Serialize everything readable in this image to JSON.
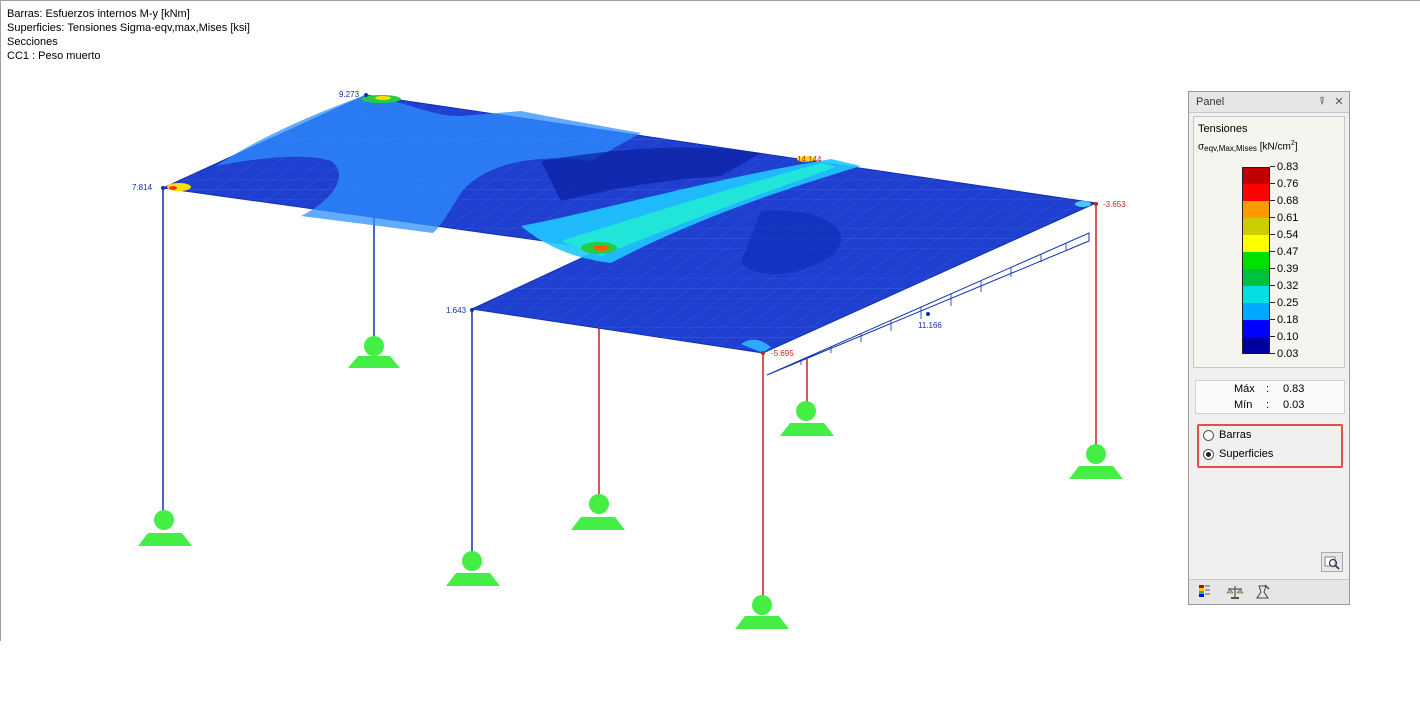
{
  "info": {
    "line1": "Barras: Esfuerzos internos M-y [kNm]",
    "line2": "Superficies: Tensiones Sigma-eqv,max,Mises [ksi]",
    "line3": "Secciones",
    "line4": "CC1 : Peso muerto"
  },
  "labels": {
    "v1": "9.273",
    "v2": "7.814",
    "v3": "1.643",
    "v4": "-3.653",
    "v5": "-5.695",
    "v6": "11.166",
    "v7": "14.144"
  },
  "panel": {
    "title": "Panel",
    "pin_icon": "pin-icon",
    "close_icon": "close-icon",
    "heading": "Tensiones",
    "quantity_symbol": "σ",
    "quantity_sub": "eqv,Max,Mises",
    "quantity_unit": "[kN/cm",
    "quantity_unit_exp": "2",
    "quantity_unit_close": "]",
    "legend": [
      {
        "value": "0.83",
        "color": "#c00000"
      },
      {
        "value": "0.76",
        "color": "#ff0000"
      },
      {
        "value": "0.68",
        "color": "#ff9900"
      },
      {
        "value": "0.61",
        "color": "#cccc00"
      },
      {
        "value": "0.54",
        "color": "#ffff00"
      },
      {
        "value": "0.47",
        "color": "#00e000"
      },
      {
        "value": "0.39",
        "color": "#00c040"
      },
      {
        "value": "0.32",
        "color": "#00e0e0"
      },
      {
        "value": "0.25",
        "color": "#00a8ff"
      },
      {
        "value": "0.18",
        "color": "#0000ff"
      },
      {
        "value": "0.10",
        "color": "#0000a0"
      }
    ],
    "legend_bottom_value": "0.03",
    "max_label": "Máx",
    "max_value": "0.83",
    "min_label": "Mín",
    "min_value": "0.03",
    "separator": ":",
    "radio_bars": "Barras",
    "radio_surfaces": "Superficies",
    "selected": "Superficies"
  },
  "colors": {
    "slab": "#1a40d8",
    "column_blue": "#1030b0",
    "column_red": "#cc2020",
    "support": "#4cff4c",
    "highlight": "#e0504a"
  }
}
